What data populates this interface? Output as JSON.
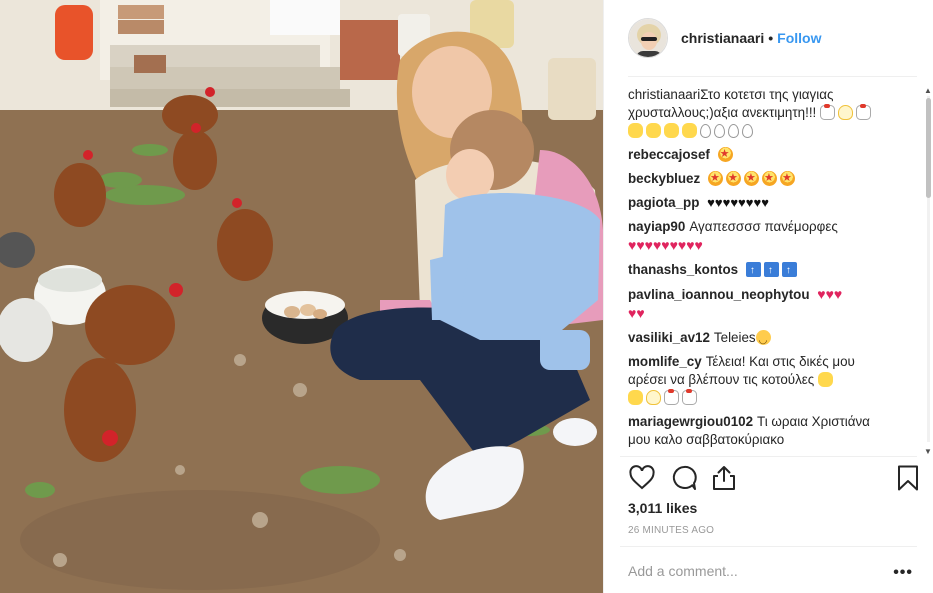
{
  "post": {
    "username": "christianaari",
    "follow_label": "Follow",
    "caption": "Στο κοτετσι της γιαγιας χρυσταλλους;)αξια ανεκτιμητη!!!",
    "caption_emojis": [
      "rooster",
      "hatch",
      "rooster",
      "chick",
      "chick",
      "chick",
      "chick",
      "egg",
      "egg",
      "egg",
      "egg"
    ]
  },
  "comments": [
    {
      "user": "rebeccajosef",
      "text": "",
      "emojis": [
        "star"
      ]
    },
    {
      "user": "beckybluez",
      "text": "",
      "emojis": [
        "star",
        "star",
        "star",
        "star",
        "star"
      ]
    },
    {
      "user": "pagiota_pp",
      "text": "",
      "emojis": [
        "black-heart",
        "black-heart",
        "black-heart",
        "black-heart",
        "black-heart",
        "black-heart",
        "black-heart",
        "black-heart"
      ]
    },
    {
      "user": "nayiap90",
      "text": "Αγαπεσσσσ πανέμορφες",
      "emojis": [
        "red-heart",
        "red-heart",
        "red-heart",
        "red-heart",
        "red-heart",
        "red-heart",
        "red-heart",
        "red-heart",
        "red-heart"
      ]
    },
    {
      "user": "thanashs_kontos",
      "text": "",
      "emojis": [
        "top",
        "top",
        "top"
      ]
    },
    {
      "user": "pavlina_ioannou_neophytou",
      "text": "",
      "emojis": [
        "red-heart",
        "red-heart",
        "red-heart",
        "red-heart",
        "red-heart"
      ]
    },
    {
      "user": "vasiliki_av12",
      "text": "Teleies",
      "emojis": [
        "smile"
      ]
    },
    {
      "user": "momlife_cy",
      "text": "Τέλεια! Και στις δικές μου αρέσει να βλέπουν τις κοτούλες",
      "emojis": [
        "chick",
        "chick",
        "hatch",
        "rooster",
        "rooster"
      ]
    },
    {
      "user": "mariagewrgiou0102",
      "text": "Τι ωραια Χριστιάνα μου καλο σαββατοκύριακο",
      "emojis": []
    }
  ],
  "likes": "3,011 likes",
  "timestamp": "26 MINUTES AGO",
  "comment_input": {
    "placeholder": "Add a comment..."
  },
  "more_options": "•••",
  "colors": {
    "link": "#3897f0",
    "text": "#262626",
    "muted": "#999999",
    "divider": "#efefef",
    "heart_red": "#e0245e"
  },
  "icons": {
    "like": "heart-outline-icon",
    "comment": "speech-bubble-icon",
    "share": "share-arrow-icon",
    "save": "bookmark-icon"
  }
}
